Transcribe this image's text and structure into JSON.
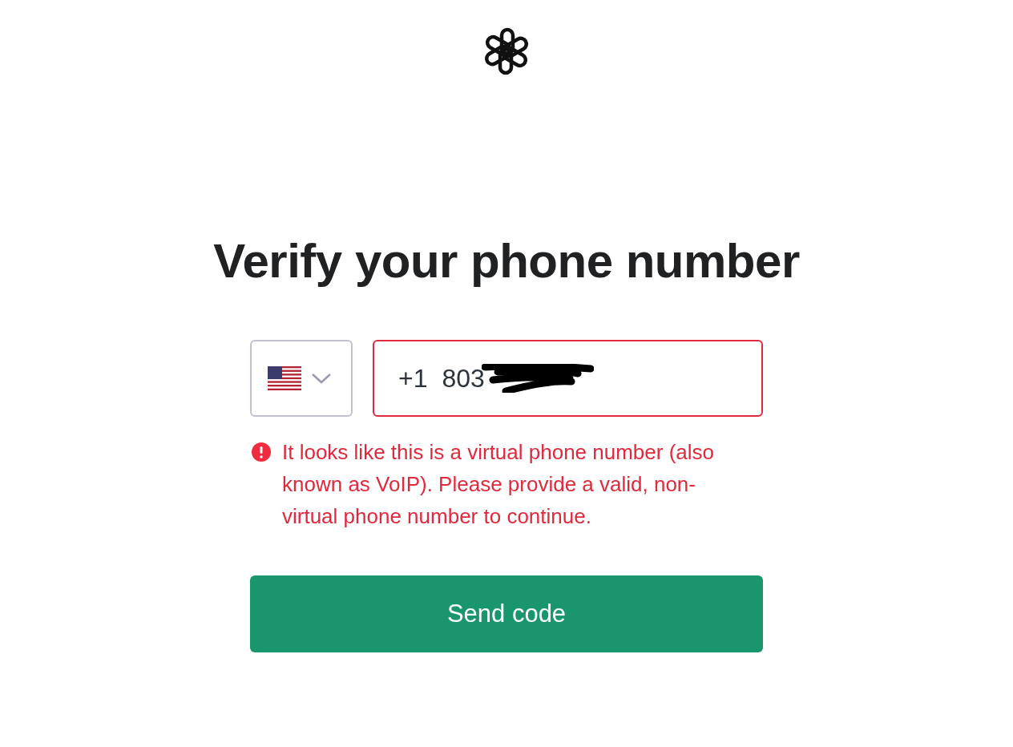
{
  "heading": "Verify your phone number",
  "phone": {
    "country_code": "+1",
    "value": "803",
    "invalid": true
  },
  "error": "It looks like this is a virtual phone number (also known as VoIP). Please provide a valid, non-virtual phone number to continue.",
  "button": "Send code"
}
